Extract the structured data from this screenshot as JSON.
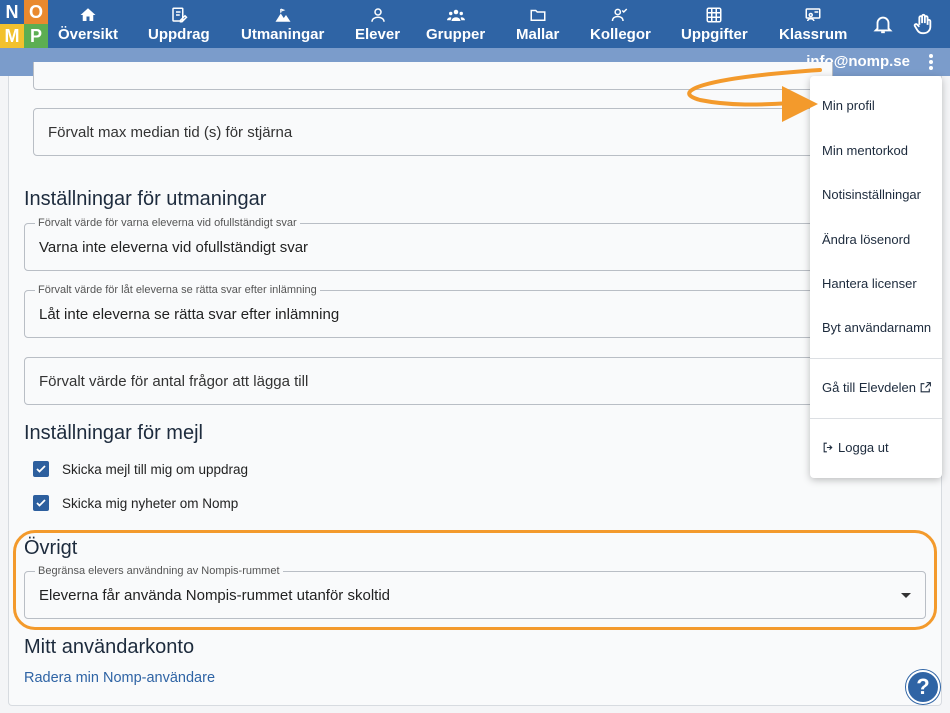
{
  "logo": {
    "letters": [
      "N",
      "O",
      "M",
      "P"
    ]
  },
  "nav": {
    "items": [
      {
        "label": "Översikt",
        "icon": "home-icon"
      },
      {
        "label": "Uppdrag",
        "icon": "edit-icon"
      },
      {
        "label": "Utmaningar",
        "icon": "mountain-icon"
      },
      {
        "label": "Elever",
        "icon": "person-icon"
      },
      {
        "label": "Grupper",
        "icon": "group-icon"
      },
      {
        "label": "Mallar",
        "icon": "folder-icon"
      },
      {
        "label": "Kollegor",
        "icon": "colleagues-icon"
      },
      {
        "label": "Uppgifter",
        "icon": "grid-icon"
      },
      {
        "label": "Klassrum",
        "icon": "classroom-icon"
      }
    ],
    "bell_icon": "bell-icon",
    "hand_icon": "hand-icon"
  },
  "user": {
    "email": "info@nomp.se"
  },
  "settings": {
    "star_field_placeholder": "Förvalt max median tid (s) för stjärna",
    "challenges_title": "Inställningar för utmaningar",
    "warn_field": {
      "legend": "Förvalt värde för varna eleverna vid ofullständigt svar",
      "value": "Varna inte eleverna vid ofullständigt svar"
    },
    "correct_field": {
      "legend": "Förvalt värde för låt eleverna se rätta svar efter inlämning",
      "value": "Låt inte eleverna se rätta svar efter inlämning"
    },
    "questions_field_placeholder": "Förvalt värde för antal frågor att lägga till",
    "email_title": "Inställningar för mejl",
    "email_checks": [
      {
        "label": "Skicka mejl till mig om uppdrag",
        "checked": true
      },
      {
        "label": "Skicka mig nyheter om Nomp",
        "checked": true
      }
    ],
    "other_title": "Övrigt",
    "nompis_field": {
      "legend": "Begränsa elevers användning av Nompis-rummet",
      "value": "Eleverna får använda Nompis-rummet utanför skoltid"
    },
    "account_title": "Mitt användarkonto",
    "delete_link": "Radera min Nomp-användare"
  },
  "menu": {
    "items": [
      {
        "label": "Min profil"
      },
      {
        "label": "Min mentorkod"
      },
      {
        "label": "Notisinställningar"
      },
      {
        "label": "Ändra lösenord"
      },
      {
        "label": "Hantera licenser"
      },
      {
        "label": "Byt användarnamn"
      },
      {
        "label": "Gå till Elevdelen"
      },
      {
        "label": "Logga ut"
      }
    ]
  },
  "help": {
    "symbol": "?"
  },
  "colors": {
    "nav": "#2f64a5",
    "subbar": "#7b9ccb",
    "accent": "#f39a2c"
  }
}
